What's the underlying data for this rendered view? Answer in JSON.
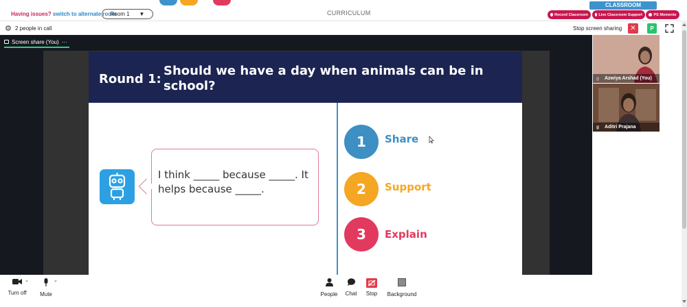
{
  "topbar": {
    "issue_question": "Having issues?",
    "issue_link": "switch to alternate room",
    "room_label": "Room 1",
    "room_caret": "▼",
    "curriculum": "CURRICULUM",
    "classroom_tab": "CLASSROOM",
    "buttons": [
      "Record Classroom",
      "Live Classroom Support",
      "PS Moments"
    ]
  },
  "callbar": {
    "people_count": "2 people in call",
    "stop_share": "Stop screen sharing",
    "close_glyph": "✕",
    "p_badge": "P"
  },
  "share": {
    "tab_label": "Screen share (You)",
    "tab_menu": "···"
  },
  "slide": {
    "round_label": "Round 1:",
    "question": "Should we have a day when animals can be in school?",
    "bubble_text": "I think _____ because _____. It helps because _____.",
    "steps": [
      {
        "number": "1",
        "label": "Share",
        "color": "#3d8fc4"
      },
      {
        "number": "2",
        "label": "Support",
        "color": "#f5a623"
      },
      {
        "number": "3",
        "label": "Explain",
        "color": "#e23a5e"
      }
    ]
  },
  "participants": [
    {
      "name": "Azwiya Arshad (You)"
    },
    {
      "name": "Aditri Prajana"
    }
  ],
  "bottombar": {
    "turn_off": "Turn off",
    "mute": "Mute",
    "people": "People",
    "chat": "Chat",
    "stop": "Stop",
    "background": "Background"
  },
  "colors": {
    "slide_header": "#1c2452",
    "accent_red": "#c8174f",
    "classroom_blue": "#3d93cc"
  }
}
